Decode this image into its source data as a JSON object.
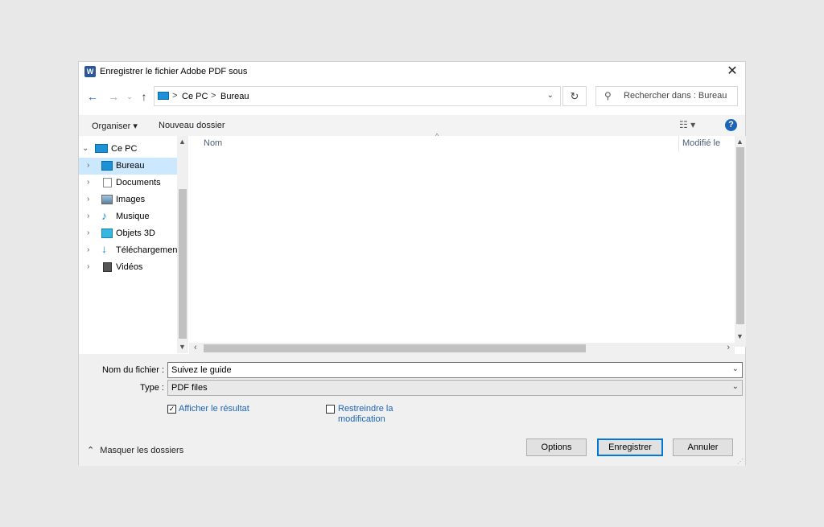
{
  "dialog": {
    "title": "Enregistrer le fichier Adobe PDF sous",
    "app_icon": "W",
    "close_glyph": "✕"
  },
  "address": {
    "crumbs": [
      "Ce PC",
      "Bureau"
    ],
    "separator": ">"
  },
  "search": {
    "placeholder": "Rechercher dans : Bureau"
  },
  "toolbar": {
    "organize": "Organiser ▾",
    "new_folder": "Nouveau dossier",
    "help": "?"
  },
  "nav": {
    "items": [
      {
        "label": "Ce PC",
        "icon": "pc-icon"
      },
      {
        "label": "Bureau",
        "icon": "desktop-icon"
      },
      {
        "label": "Documents",
        "icon": "documents-icon"
      },
      {
        "label": "Images",
        "icon": "images-icon"
      },
      {
        "label": "Musique",
        "icon": "music-icon"
      },
      {
        "label": "Objets 3D",
        "icon": "objects3d-icon"
      },
      {
        "label": "Téléchargements",
        "icon": "downloads-icon"
      },
      {
        "label": "Vidéos",
        "icon": "videos-icon"
      }
    ]
  },
  "columns": {
    "name": "Nom",
    "modified": "Modifié le"
  },
  "form": {
    "filename_label": "Nom du fichier :",
    "filename_value": "Suivez le guide",
    "type_label": "Type :",
    "type_value": "PDF files",
    "show_result": "Afficher le résultat",
    "show_result_checked": true,
    "restrict_line1": "Restreindre la",
    "restrict_line2": "modification",
    "restrict_checked": false
  },
  "footer": {
    "hide_folders": "Masquer les dossiers",
    "options": "Options",
    "save": "Enregistrer",
    "cancel": "Annuler"
  },
  "colors": {
    "accent": "#0078d7",
    "selection": "#cce8ff",
    "link": "#1c64b8"
  }
}
